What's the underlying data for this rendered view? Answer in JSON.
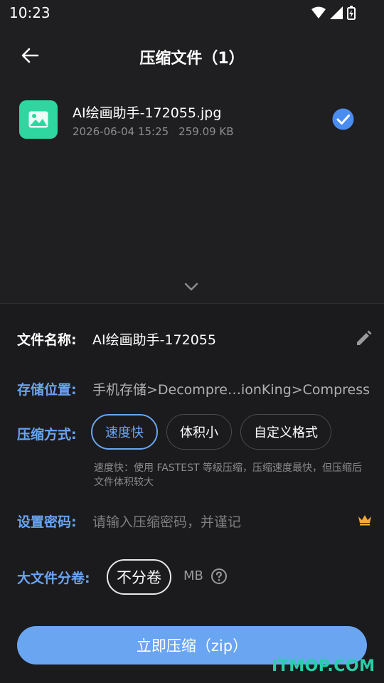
{
  "status_bar": {
    "time": "10:23",
    "icons": [
      "wifi-icon",
      "signal-icon",
      "battery-charging-icon"
    ]
  },
  "app_bar": {
    "back_icon": "arrow-left-icon",
    "title": "压缩文件（1）"
  },
  "file": {
    "name": "AI绘画助手-172055.jpg",
    "date": "2026-06-04 15:25",
    "size": "259.09 KB",
    "thumb_icon": "image-icon",
    "selected": true
  },
  "form": {
    "filename": {
      "label": "文件名称:",
      "value": "AI绘画助手-172055",
      "icon": "edit-pencil-icon"
    },
    "location": {
      "label": "存储位置:",
      "value": "手机存储>Decompre…ionKing>Compress"
    },
    "method": {
      "label": "压缩方式:",
      "options": [
        "速度快",
        "体积小",
        "自定义格式"
      ],
      "selected": "速度快",
      "hint": "速度快：使用 FASTEST 等级压缩，压缩速度最快，但压缩后文件体积较大"
    },
    "password": {
      "label": "设置密码:",
      "placeholder": "请输入压缩密码，并谨记",
      "icon": "crown-icon"
    },
    "split": {
      "label": "大文件分卷:",
      "value": "不分卷",
      "unit": "MB",
      "icon": "help-circle-icon"
    }
  },
  "primary_button": {
    "label": "立即压缩（zip）"
  },
  "watermark": "ITMOP.COM",
  "colors": {
    "accent": "#6aa5f2",
    "thumb": "#2fd6a0",
    "check": "#4a8df0",
    "crown": "#f4a83a"
  }
}
